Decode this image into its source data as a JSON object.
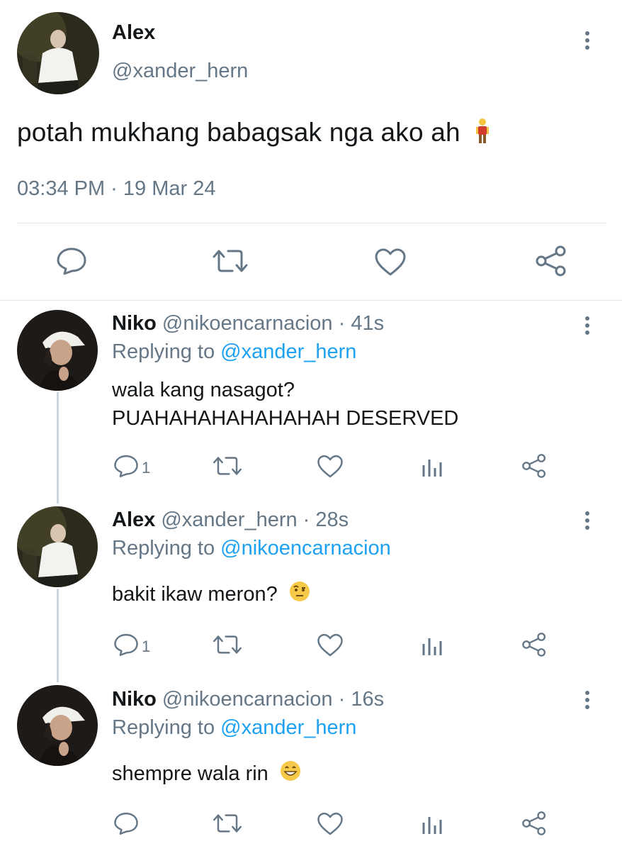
{
  "main_tweet": {
    "name": "Alex",
    "handle": "@xander_hern",
    "text": "potah mukhang babagsak nga ako ah",
    "emoji": "person-standing-emoji",
    "timestamp": "03:34 PM · 19 Mar 24",
    "actions": [
      "reply-icon",
      "retweet-icon",
      "like-icon",
      "share-icon"
    ]
  },
  "replies": [
    {
      "name": "Niko",
      "handle": "@nikoencarnacion",
      "time": "· 41s",
      "replying_label": "Replying to",
      "replying_to": "@xander_hern",
      "lines": [
        "wala kang nasagot?",
        "PUAHAHAHAHAHAHAH DESERVED"
      ],
      "reply_count": "1"
    },
    {
      "name": "Alex",
      "handle": "@xander_hern",
      "time": "· 28s",
      "replying_label": "Replying to",
      "replying_to": "@nikoencarnacion",
      "lines": [
        "bakit ikaw meron?"
      ],
      "emoji": "face-with-raised-eyebrow-emoji",
      "reply_count": "1"
    },
    {
      "name": "Niko",
      "handle": "@nikoencarnacion",
      "time": "· 16s",
      "replying_label": "Replying to",
      "replying_to": "@xander_hern",
      "lines": [
        "shempre wala rin"
      ],
      "emoji": "grinning-face-emoji",
      "reply_count": ""
    }
  ],
  "colors": {
    "text": "#14171a",
    "secondary": "#657786",
    "link": "#1da1f2",
    "divider": "#e1e8ed",
    "thread_line": "#ccd6dd"
  }
}
